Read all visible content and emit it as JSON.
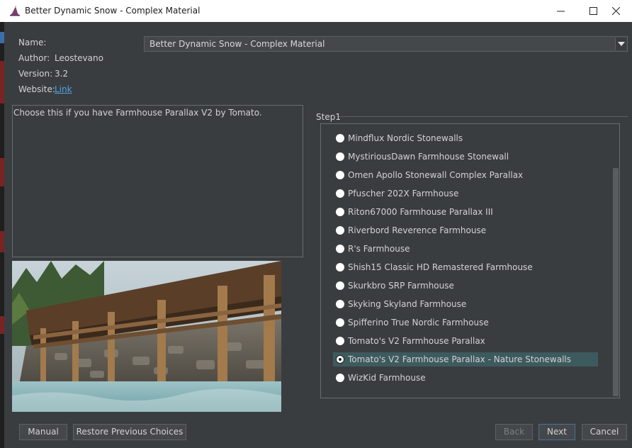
{
  "window": {
    "title": "Better Dynamic Snow - Complex Material",
    "controls": [
      "minimize",
      "maximize",
      "close"
    ]
  },
  "info": {
    "name_label": "Name:",
    "author_label": "Author:",
    "author_value": "Leostevano",
    "version_label": "Version:",
    "version_value": "3.2",
    "website_label": "Website:",
    "website_link": "Link"
  },
  "name_select": {
    "selected": "Better Dynamic Snow - Complex Material"
  },
  "description": "Choose this if you have Farmhouse Parallax V2 by Tomato.",
  "step": {
    "title": "Step1",
    "options": [
      "Mindflux Nordic Stonewalls",
      "MystiriousDawn Farmhouse Stonewall",
      "Omen Apollo Stonewall Complex Parallax",
      "Pfuscher 202X Farmhouse",
      "Riton67000 Farmhouse Parallax III",
      "Riverbord Reverence Farmhouse",
      "R's Farmhouse",
      "Shish15 Classic HD Remastered Farmhouse",
      "Skurkbro SRP Farmhouse",
      "Skyking Skyland Farmhouse",
      "Spifferino True Nordic Farmhouse",
      "Tomato's V2 Farmhouse Parallax",
      "Tomato's V2 Farmhouse Parallax - Nature Stonewalls",
      "WizKid Farmhouse"
    ],
    "selected_option": "Tomato's V2 Farmhouse Parallax - Nature Stonewalls"
  },
  "buttons": {
    "manual": "Manual",
    "restore": "Restore Previous Choices",
    "back": "Back",
    "next": "Next",
    "cancel": "Cancel"
  },
  "colors": {
    "background": "#3a3d40",
    "selection": "#3d5a5e",
    "link": "#4ea6ea"
  }
}
